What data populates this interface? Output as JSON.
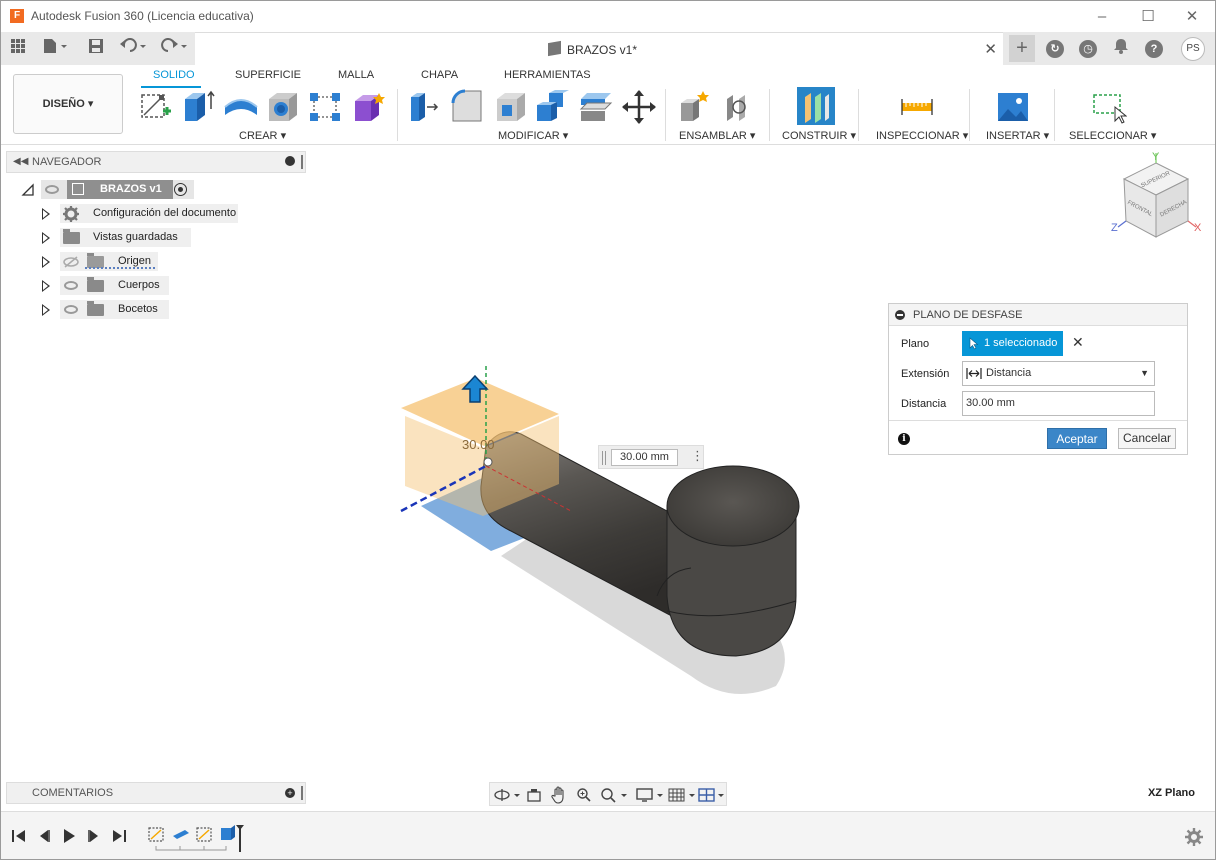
{
  "titlebar": {
    "app_icon_letter": "F",
    "title": "Autodesk Fusion 360 (Licencia educativa)"
  },
  "tabs": {
    "document_title": "BRAZOS v1*",
    "user_initials": "PS"
  },
  "ribbon": {
    "workspace": "DISEÑO",
    "tabs": [
      "SOLIDO",
      "SUPERFICIE",
      "MALLA",
      "CHAPA",
      "HERRAMIENTAS"
    ],
    "active_tab": "SOLIDO",
    "groups": [
      "CREAR",
      "MODIFICAR",
      "ENSAMBLAR",
      "CONSTRUIR",
      "INSPECCIONAR",
      "INSERTAR",
      "SELECCIONAR"
    ]
  },
  "navigator": {
    "title": "NAVEGADOR",
    "root": "BRAZOS v1",
    "items": [
      "Configuración del documento",
      "Vistas guardadas",
      "Origen",
      "Cuerpos",
      "Bocetos"
    ]
  },
  "viewcube": {
    "top": "SUPERIOR",
    "front": "FRONTAL",
    "right": "DERECHA",
    "axis_x": "X",
    "axis_y": "Y",
    "axis_z": "Z"
  },
  "dialog": {
    "title": "PLANO DE DESFASE",
    "plane_label": "Plano",
    "plane_value": "1 seleccionado",
    "extension_label": "Extensión",
    "extension_value": "Distancia",
    "distance_label": "Distancia",
    "distance_value": "30.00 mm",
    "ok": "Aceptar",
    "cancel": "Cancelar"
  },
  "viewport": {
    "dim_input": "30.00 mm",
    "dim_label": "30.00",
    "plane_status": "XZ Plano"
  },
  "comments": {
    "title": "COMENTARIOS"
  },
  "colors": {
    "accent": "#0696d7",
    "ok_button": "#3b86c8",
    "body": "#5a5753",
    "offset_plane": "#f5c272",
    "base_plane": "#6a9fd8"
  }
}
